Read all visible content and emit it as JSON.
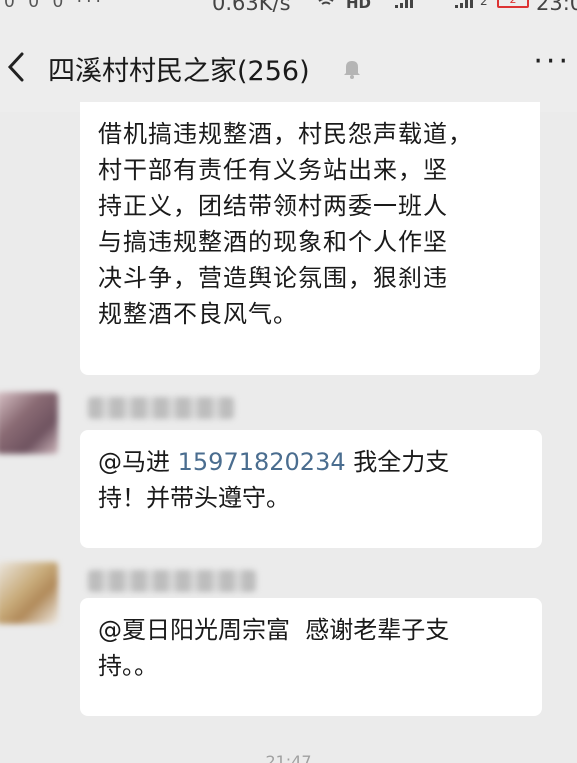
{
  "status_bar": {
    "left_icons": "0 0 0 ···",
    "network_speed": "0.63K/s",
    "hd_label": "HD",
    "sim2_label": "2",
    "battery": "2",
    "time": "23:0"
  },
  "header": {
    "title": "四溪村村民之家(256)",
    "icons": {
      "back": "chevron-left-icon",
      "mute": "bell-muted-icon",
      "more": "ellipsis-icon"
    },
    "more_label": "···"
  },
  "messages": [
    {
      "lines": [
        "借机搞违规整酒，村民怨声载道，",
        "村干部有责任有义务站出来，坚",
        "持正义，团结带领村两委一班人",
        "与搞违规整酒的现象和个人作坚",
        "决斗争，营造舆论氛围，狠刹违",
        "规整酒不良风气。"
      ]
    },
    {
      "mention": "@马进",
      "phone": "15971820234",
      "text_after_phone": "我全力支",
      "line2": "持！并带头遵守。"
    },
    {
      "line1": "@夏日阳光周宗富  感谢老辈子支",
      "line2": "持。。"
    }
  ],
  "timestamp": "21:47",
  "colors": {
    "background": "#ebebeb",
    "bubble": "#ffffff",
    "link": "#4a6d8f",
    "nav_bg": "#ededed"
  }
}
